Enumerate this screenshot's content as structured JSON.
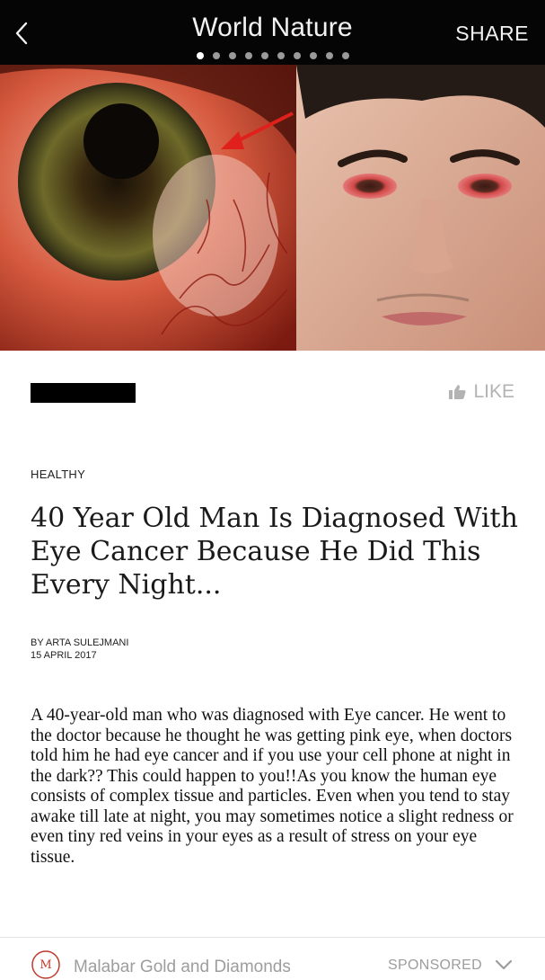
{
  "topbar": {
    "title": "World Nature",
    "share_label": "SHARE",
    "back_icon": "chevron-left-icon",
    "pager": {
      "total": 10,
      "active_index": 0
    }
  },
  "hero": {
    "description_icon": "article-hero-image"
  },
  "article": {
    "like_label": "LIKE",
    "like_icon": "thumbs-up-icon",
    "category": "HEALTHY",
    "title": "40 Year Old Man Is Diagnosed With Eye Cancer Because He Did This Every Night...",
    "author": "BY ARTA SULEJMANI",
    "date": "15 APRIL 2017",
    "body": "A 40-year-old man who was diagnosed with Eye cancer. He went to the doctor because he thought he was getting pink eye, when doctors told him he had eye cancer and if you use your cell phone at night in the dark?? This could happen to you!!As you know the human eye consists of complex tissue and particles. Even when you tend to stay awake till late at night, you may sometimes notice a slight redness or even tiny red veins in your eyes as a result of stress on your eye tissue."
  },
  "ad": {
    "name": "Malabar Gold and Diamonds",
    "sponsored_label": "SPONSORED",
    "logo_text": "MALABAR"
  },
  "colors": {
    "topbar_bg": "#050505",
    "like_gray": "#b3b3b3",
    "ad_gray": "#9d9d9d",
    "brand_red": "#c0392b"
  }
}
